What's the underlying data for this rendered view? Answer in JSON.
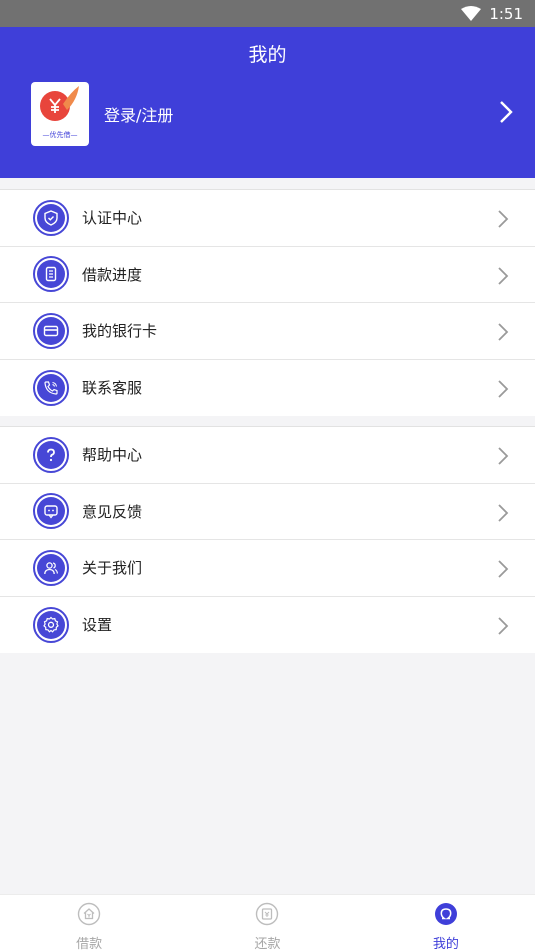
{
  "status_bar": {
    "time": "1:51"
  },
  "header": {
    "title": "我的",
    "login_label": "登录/注册",
    "logo_text": "—优先借—"
  },
  "menu_groups": [
    [
      {
        "label": "认证中心",
        "icon": "shield-icon"
      },
      {
        "label": "借款进度",
        "icon": "document-icon"
      },
      {
        "label": "我的银行卡",
        "icon": "bank-card-icon"
      },
      {
        "label": "联系客服",
        "icon": "phone-icon"
      }
    ],
    [
      {
        "label": "帮助中心",
        "icon": "question-icon"
      },
      {
        "label": "意见反馈",
        "icon": "chat-icon"
      },
      {
        "label": "关于我们",
        "icon": "users-icon"
      },
      {
        "label": "设置",
        "icon": "gear-icon"
      }
    ]
  ],
  "bottom_nav": [
    {
      "label": "借款",
      "icon": "loan-icon",
      "active": false
    },
    {
      "label": "还款",
      "icon": "repay-icon",
      "active": false
    },
    {
      "label": "我的",
      "icon": "profile-icon",
      "active": true
    }
  ],
  "colors": {
    "accent": "#3f3fd9",
    "inactive": "#a7a7a7",
    "logo_red": "#e8453c"
  }
}
